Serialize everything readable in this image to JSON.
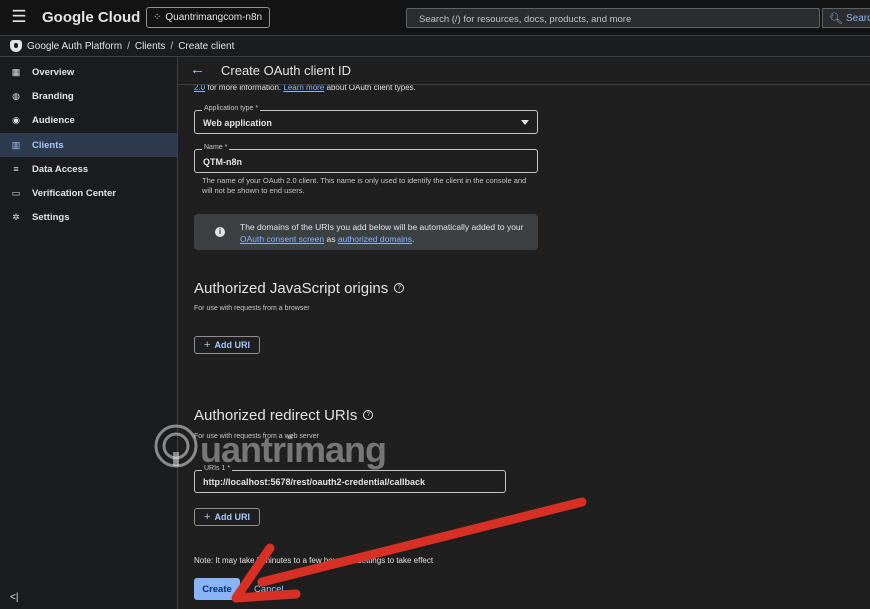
{
  "topbar": {
    "brand": "Google Cloud",
    "project": "Quantrimangcom-n8n",
    "search_placeholder": "Search (/) for resources, docs, products, and more",
    "search_button": "Search"
  },
  "breadcrumb": [
    "Google Auth Platform",
    "Clients",
    "Create client"
  ],
  "sidebar": {
    "items": [
      {
        "label": "Overview",
        "icon": "overview-icon"
      },
      {
        "label": "Branding",
        "icon": "palette-icon"
      },
      {
        "label": "Audience",
        "icon": "person-icon"
      },
      {
        "label": "Clients",
        "icon": "key-icon",
        "active": true
      },
      {
        "label": "Data Access",
        "icon": "data-access-icon"
      },
      {
        "label": "Verification Center",
        "icon": "verification-icon"
      },
      {
        "label": "Settings",
        "icon": "gear-icon"
      }
    ],
    "collapse": "<|"
  },
  "header": {
    "title": "Create OAuth client ID"
  },
  "intro": {
    "prefix": "2.0",
    "text1": " for more information. ",
    "link": "Learn more",
    "text2": " about OAuth client types."
  },
  "form": {
    "app_type_label": "Application type *",
    "app_type_value": "Web application",
    "name_label": "Name *",
    "name_value": "QTM-n8n",
    "name_help": "The name of your OAuth 2.0 client. This name is only used to identify the client in the console and will not be shown to end users."
  },
  "info": {
    "text1": "The domains of the URIs you add below will be automatically added to your ",
    "link1": "OAuth consent screen",
    "text2": " as ",
    "link2": "authorized domains",
    "text3": "."
  },
  "js_origins": {
    "title": "Authorized JavaScript origins",
    "subtitle": "For use with requests from a browser",
    "add_button": "Add URI"
  },
  "redirect": {
    "title": "Authorized redirect URIs",
    "subtitle": "For use with requests from a web server",
    "uri_label": "URIs 1 *",
    "uri_value": "http://localhost:5678/rest/oauth2-credential/callback",
    "add_button": "Add URI"
  },
  "note": "Note: It may take 5 minutes to a few hours for settings to take effect",
  "actions": {
    "create": "Create",
    "cancel": "Cancel"
  },
  "watermark": "uantrimang",
  "colors": {
    "accent": "#8ab4f8",
    "annotation_arrow": "#d93025",
    "background": "#1f1f1f"
  }
}
